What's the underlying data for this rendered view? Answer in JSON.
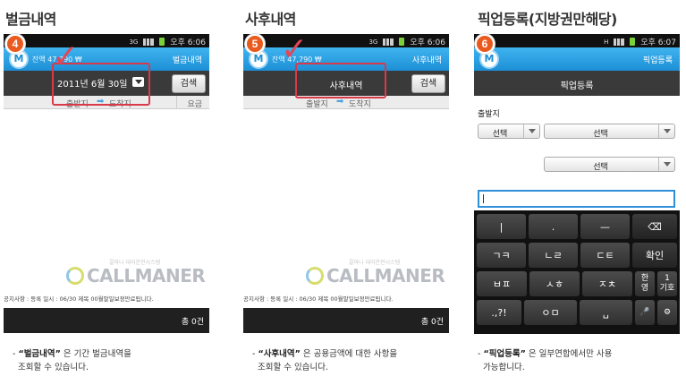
{
  "panels": [
    {
      "title": "벌금내역",
      "badge": "4",
      "status_time": "오후 6:06",
      "app": {
        "logo": "M",
        "amount": "잔액 47,790 ₩",
        "title": "벌금내역"
      },
      "date_value": "2011년 6월 30일",
      "search_label": "검색",
      "columns": {
        "departure": "출발지",
        "arrival": "도착지",
        "fee": "요금"
      },
      "watermark_sub": "콜마니 대리운전시스템",
      "watermark": "CALLMANER",
      "notice": "공지사항 : 등록 일시 : 06/30 제목 00월말일보정만료됩니다.",
      "total": "총 0건",
      "caption_strong": "“벌금내역”",
      "caption_rest": " 은 기간 벌금내역을",
      "caption_line2": "조회할 수 있습니다."
    },
    {
      "title": "사후내역",
      "badge": "5",
      "status_time": "오후 6:06",
      "app": {
        "logo": "M",
        "amount": "잔액 47,790 ₩",
        "title": "사후내역"
      },
      "recent_label": "사후내역",
      "search_label": "검색",
      "columns": {
        "departure": "출발지",
        "arrival": "도착지"
      },
      "watermark_sub": "콜마니 대리운전시스템",
      "watermark": "CALLMANER",
      "notice": "공지사항 : 등록 일시 : 06/30 제목 00월말일보정만료됩니다.",
      "total": "총 0건",
      "caption_strong": "“사후내역”",
      "caption_rest": " 은 공용금액에 대한 사항을",
      "caption_line2": "조회할 수 있습니다."
    },
    {
      "title": "픽업등록(지방권만해당)",
      "badge": "6",
      "status_time": "오후 6:07",
      "app": {
        "logo": "M",
        "title": "픽업등록"
      },
      "toolbar_label": "픽업등록",
      "dep_label": "출발지",
      "select_small": "선택",
      "select_large": "선택",
      "select_third": "선택",
      "keyboard": {
        "row1": [
          "|",
          ".",
          "—",
          "⌫"
        ],
        "row2": [
          "ㄱㅋ",
          "ㄴㄹ",
          "ㄷㅌ",
          "확인"
        ],
        "row3": [
          "ㅂㅍ",
          "ㅅㅎ",
          "ㅈㅊ",
          "한",
          "영",
          "1",
          "기호"
        ],
        "row4": [
          ".,?!",
          "ㅇㅁ",
          "␣",
          "🎤",
          "⚙"
        ]
      },
      "caption_strong": "“픽업등록”",
      "caption_rest": " 은 일부연합에서만 사용",
      "caption_line2": "가능합니다."
    }
  ],
  "colors": {
    "badge": "#ea5a1e",
    "highlight": "#d83a4a",
    "appbar": "#1d8fd6"
  }
}
